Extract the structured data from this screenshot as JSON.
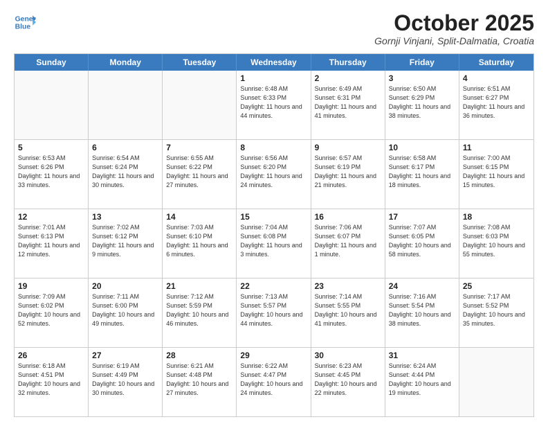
{
  "header": {
    "logo_line1": "General",
    "logo_line2": "Blue",
    "title": "October 2025",
    "subtitle": "Gornji Vinjani, Split-Dalmatia, Croatia"
  },
  "days_of_week": [
    "Sunday",
    "Monday",
    "Tuesday",
    "Wednesday",
    "Thursday",
    "Friday",
    "Saturday"
  ],
  "weeks": [
    [
      {
        "day": "",
        "text": ""
      },
      {
        "day": "",
        "text": ""
      },
      {
        "day": "",
        "text": ""
      },
      {
        "day": "1",
        "text": "Sunrise: 6:48 AM\nSunset: 6:33 PM\nDaylight: 11 hours and 44 minutes."
      },
      {
        "day": "2",
        "text": "Sunrise: 6:49 AM\nSunset: 6:31 PM\nDaylight: 11 hours and 41 minutes."
      },
      {
        "day": "3",
        "text": "Sunrise: 6:50 AM\nSunset: 6:29 PM\nDaylight: 11 hours and 38 minutes."
      },
      {
        "day": "4",
        "text": "Sunrise: 6:51 AM\nSunset: 6:27 PM\nDaylight: 11 hours and 36 minutes."
      }
    ],
    [
      {
        "day": "5",
        "text": "Sunrise: 6:53 AM\nSunset: 6:26 PM\nDaylight: 11 hours and 33 minutes."
      },
      {
        "day": "6",
        "text": "Sunrise: 6:54 AM\nSunset: 6:24 PM\nDaylight: 11 hours and 30 minutes."
      },
      {
        "day": "7",
        "text": "Sunrise: 6:55 AM\nSunset: 6:22 PM\nDaylight: 11 hours and 27 minutes."
      },
      {
        "day": "8",
        "text": "Sunrise: 6:56 AM\nSunset: 6:20 PM\nDaylight: 11 hours and 24 minutes."
      },
      {
        "day": "9",
        "text": "Sunrise: 6:57 AM\nSunset: 6:19 PM\nDaylight: 11 hours and 21 minutes."
      },
      {
        "day": "10",
        "text": "Sunrise: 6:58 AM\nSunset: 6:17 PM\nDaylight: 11 hours and 18 minutes."
      },
      {
        "day": "11",
        "text": "Sunrise: 7:00 AM\nSunset: 6:15 PM\nDaylight: 11 hours and 15 minutes."
      }
    ],
    [
      {
        "day": "12",
        "text": "Sunrise: 7:01 AM\nSunset: 6:13 PM\nDaylight: 11 hours and 12 minutes."
      },
      {
        "day": "13",
        "text": "Sunrise: 7:02 AM\nSunset: 6:12 PM\nDaylight: 11 hours and 9 minutes."
      },
      {
        "day": "14",
        "text": "Sunrise: 7:03 AM\nSunset: 6:10 PM\nDaylight: 11 hours and 6 minutes."
      },
      {
        "day": "15",
        "text": "Sunrise: 7:04 AM\nSunset: 6:08 PM\nDaylight: 11 hours and 3 minutes."
      },
      {
        "day": "16",
        "text": "Sunrise: 7:06 AM\nSunset: 6:07 PM\nDaylight: 11 hours and 1 minute."
      },
      {
        "day": "17",
        "text": "Sunrise: 7:07 AM\nSunset: 6:05 PM\nDaylight: 10 hours and 58 minutes."
      },
      {
        "day": "18",
        "text": "Sunrise: 7:08 AM\nSunset: 6:03 PM\nDaylight: 10 hours and 55 minutes."
      }
    ],
    [
      {
        "day": "19",
        "text": "Sunrise: 7:09 AM\nSunset: 6:02 PM\nDaylight: 10 hours and 52 minutes."
      },
      {
        "day": "20",
        "text": "Sunrise: 7:11 AM\nSunset: 6:00 PM\nDaylight: 10 hours and 49 minutes."
      },
      {
        "day": "21",
        "text": "Sunrise: 7:12 AM\nSunset: 5:59 PM\nDaylight: 10 hours and 46 minutes."
      },
      {
        "day": "22",
        "text": "Sunrise: 7:13 AM\nSunset: 5:57 PM\nDaylight: 10 hours and 44 minutes."
      },
      {
        "day": "23",
        "text": "Sunrise: 7:14 AM\nSunset: 5:55 PM\nDaylight: 10 hours and 41 minutes."
      },
      {
        "day": "24",
        "text": "Sunrise: 7:16 AM\nSunset: 5:54 PM\nDaylight: 10 hours and 38 minutes."
      },
      {
        "day": "25",
        "text": "Sunrise: 7:17 AM\nSunset: 5:52 PM\nDaylight: 10 hours and 35 minutes."
      }
    ],
    [
      {
        "day": "26",
        "text": "Sunrise: 6:18 AM\nSunset: 4:51 PM\nDaylight: 10 hours and 32 minutes."
      },
      {
        "day": "27",
        "text": "Sunrise: 6:19 AM\nSunset: 4:49 PM\nDaylight: 10 hours and 30 minutes."
      },
      {
        "day": "28",
        "text": "Sunrise: 6:21 AM\nSunset: 4:48 PM\nDaylight: 10 hours and 27 minutes."
      },
      {
        "day": "29",
        "text": "Sunrise: 6:22 AM\nSunset: 4:47 PM\nDaylight: 10 hours and 24 minutes."
      },
      {
        "day": "30",
        "text": "Sunrise: 6:23 AM\nSunset: 4:45 PM\nDaylight: 10 hours and 22 minutes."
      },
      {
        "day": "31",
        "text": "Sunrise: 6:24 AM\nSunset: 4:44 PM\nDaylight: 10 hours and 19 minutes."
      },
      {
        "day": "",
        "text": ""
      }
    ]
  ]
}
